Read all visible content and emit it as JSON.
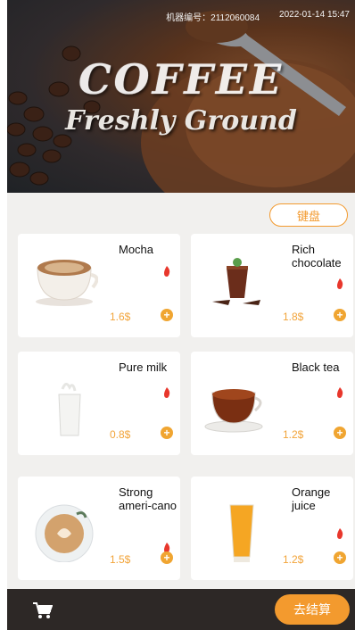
{
  "status_bar": {
    "machine_id": "机器编号：2112060084",
    "datetime": "2022-01-14  15:47"
  },
  "banner": {
    "title": "COFFEE",
    "subtitle": "Freshly  Ground"
  },
  "keyboard_button": "键盘",
  "products": [
    {
      "name": "Mocha",
      "price": "1.6$",
      "icon": "coffee-cup-icon"
    },
    {
      "name": "Rich chocolate",
      "price": "1.8$",
      "icon": "chocolate-glass-icon"
    },
    {
      "name": "Pure milk",
      "price": "0.8$",
      "icon": "milk-glass-icon"
    },
    {
      "name": "Black tea",
      "price": "1.2$",
      "icon": "tea-cup-icon"
    },
    {
      "name": "Strong ameri-cano",
      "price": "1.5$",
      "icon": "latte-cup-icon"
    },
    {
      "name": "Orange juice",
      "price": "1.2$",
      "icon": "juice-glass-icon"
    }
  ],
  "footer": {
    "checkout_label": "去结算"
  },
  "colors": {
    "accent": "#f39a2e",
    "price": "#f2a43a",
    "flame": "#e8372c",
    "footer_bg": "#2d2826"
  }
}
